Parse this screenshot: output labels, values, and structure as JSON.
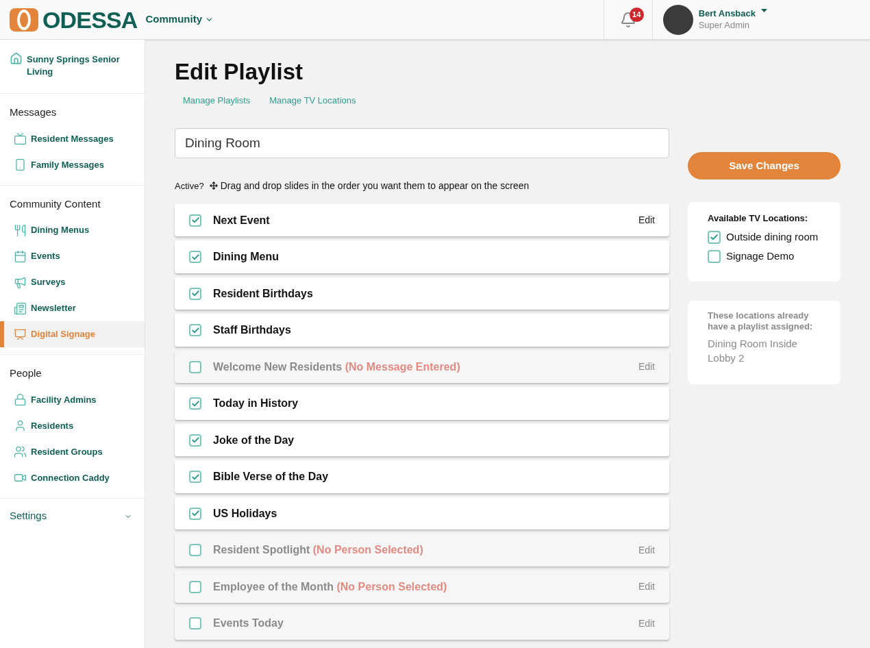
{
  "header": {
    "logo_text": "ODESSA",
    "community_menu": "Community",
    "notifications": {
      "count": "14"
    },
    "user": {
      "name": "Bert Ansback",
      "role": "Super Admin"
    }
  },
  "sidebar": {
    "home": {
      "label": "Sunny Springs Senior Living"
    },
    "sections": [
      {
        "heading": "Messages",
        "items": [
          {
            "label": "Resident Messages",
            "selected": false
          },
          {
            "label": "Family Messages",
            "selected": false
          }
        ]
      },
      {
        "heading": "Community Content",
        "items": [
          {
            "label": "Dining Menus",
            "selected": false
          },
          {
            "label": "Events",
            "selected": false
          },
          {
            "label": "Surveys",
            "selected": false
          },
          {
            "label": "Newsletter",
            "selected": false
          },
          {
            "label": "Digital Signage",
            "selected": true
          }
        ]
      },
      {
        "heading": "People",
        "items": [
          {
            "label": "Facility Admins",
            "selected": false
          },
          {
            "label": "Residents",
            "selected": false
          },
          {
            "label": "Resident Groups",
            "selected": false
          },
          {
            "label": "Connection Caddy",
            "selected": false
          }
        ]
      }
    ],
    "settings": {
      "label": "Settings",
      "expanded": false
    }
  },
  "page": {
    "title": "Edit Playlist",
    "links": [
      "Manage Playlists",
      "Manage TV Locations"
    ],
    "name_field": {
      "value": "Dining Room"
    },
    "save_button": "Save Changes",
    "active_label": "Active?",
    "instructions": "Drag and drop slides in the order you want them to appear on the screen"
  },
  "slides": [
    {
      "title": "Next Event",
      "checked": true,
      "edit": "Edit"
    },
    {
      "title": "Dining Menu",
      "checked": true
    },
    {
      "title": "Resident Birthdays",
      "checked": true
    },
    {
      "title": "Staff Birthdays",
      "checked": true
    },
    {
      "title": "Welcome New Residents",
      "note": "(No Message Entered)",
      "checked": false,
      "edit": "Edit"
    },
    {
      "title": "Today in History",
      "checked": true
    },
    {
      "title": "Joke of the Day",
      "checked": true
    },
    {
      "title": "Bible Verse of the Day",
      "checked": true
    },
    {
      "title": "US Holidays",
      "checked": true
    },
    {
      "title": "Resident Spotlight",
      "note": "(No Person Selected)",
      "checked": false,
      "edit": "Edit"
    },
    {
      "title": "Employee of the Month",
      "note": "(No Person Selected)",
      "checked": false,
      "edit": "Edit"
    },
    {
      "title": "Events Today",
      "checked": false,
      "edit": "Edit"
    }
  ],
  "tv_locations": {
    "heading": "Available TV Locations:",
    "items": [
      {
        "label": "Outside dining room",
        "checked": true
      },
      {
        "label": "Signage Demo",
        "checked": false
      }
    ]
  },
  "assigned_locations": {
    "heading": "These locations already have a playlist assigned:",
    "items": [
      "Dining Room Inside",
      "Lobby 2"
    ]
  }
}
